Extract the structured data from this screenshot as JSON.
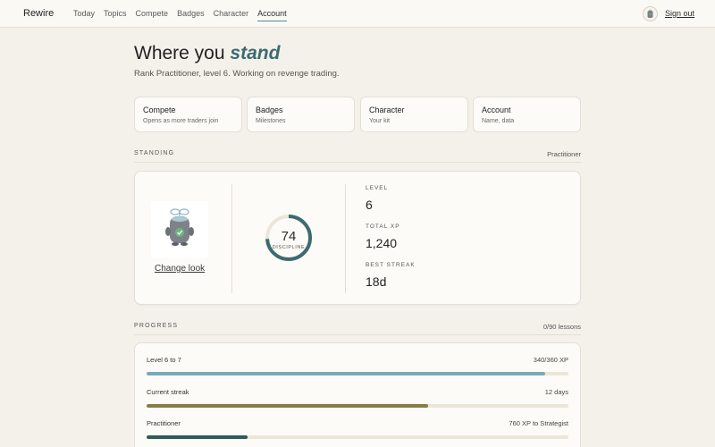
{
  "app": {
    "brand": "Rewire"
  },
  "nav": {
    "items": [
      {
        "label": "Today"
      },
      {
        "label": "Topics"
      },
      {
        "label": "Compete"
      },
      {
        "label": "Badges"
      },
      {
        "label": "Character"
      },
      {
        "label": "Account",
        "active": true
      }
    ],
    "sign_out": "Sign out"
  },
  "header": {
    "title_plain": "Where you",
    "title_accent": "stand",
    "subtitle": "Rank Practitioner, level 6. Working on revenge trading."
  },
  "cards": [
    {
      "title": "Compete",
      "desc": "Opens as more traders join"
    },
    {
      "title": "Badges",
      "desc": "Milestones"
    },
    {
      "title": "Character",
      "desc": "Your kit"
    },
    {
      "title": "Account",
      "desc": "Name, data"
    }
  ],
  "standing": {
    "section_label": "STANDING",
    "rank": "Practitioner",
    "change_look": "Change look",
    "discipline": {
      "value": "74",
      "label": "DISCIPLINE",
      "fraction": 0.74
    },
    "stats": [
      {
        "label": "LEVEL",
        "value": "6"
      },
      {
        "label": "TOTAL XP",
        "value": "1,240"
      },
      {
        "label": "BEST STREAK",
        "value": "18d"
      }
    ]
  },
  "progress": {
    "section_label": "PROGRESS",
    "lessons": "0/90 lessons",
    "rows": [
      {
        "label": "Level 6 to 7",
        "right": "340/360 XP",
        "fraction": 0.944,
        "color": "#7aaabb"
      },
      {
        "label": "Current streak",
        "right": "12 days",
        "fraction": 0.667,
        "color": "#8a7a44"
      },
      {
        "label": "Practitioner",
        "right": "760 XP to Strategist",
        "fraction": 0.24,
        "color": "#2f5c55"
      }
    ]
  },
  "colors": {
    "accent": "#3d6b72",
    "ring": "#3d6b72",
    "ring_track": "#ebe6d9",
    "background": "#f4f1ea"
  }
}
